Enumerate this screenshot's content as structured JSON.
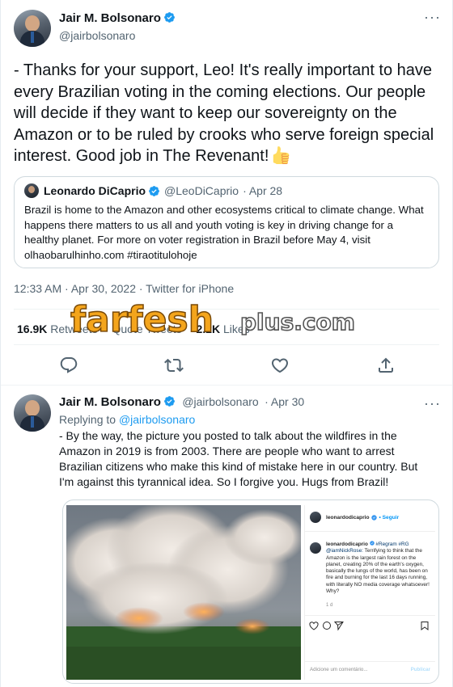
{
  "tweet": {
    "author_name": "Jair M. Bolsonaro",
    "author_handle": "@jairbolsonaro",
    "text": "- Thanks for your support, Leo! It's really important to have every Brazilian voting in the coming elections. Our people will decide if they want to keep our sovereignty on the Amazon or to be ruled by crooks who serve foreign special interest. Good job in The Revenant!",
    "quote": {
      "author_name": "Leonardo DiCaprio",
      "author_handle": "@LeoDiCaprio",
      "date": "· Apr 28",
      "text": "Brazil is home to the Amazon and other ecosystems critical to climate change. What happens there matters to us all and youth voting is key in driving change for a healthy planet. For more on voter registration in Brazil before May 4, visit olhaobarulhinho.com #tiraotitulohoje"
    },
    "timestamp": "12:33 AM · Apr 30, 2022 · Twitter for iPhone",
    "stats": {
      "retweets_count": "16.9K",
      "retweets_label": "Retweets",
      "quotes_count": "",
      "quotes_label": "Quote Tweets",
      "likes_count": "2.2K",
      "likes_label": "Likes"
    }
  },
  "watermark": {
    "brand": "farfesh",
    "suffix": "plus.com"
  },
  "reply": {
    "author_name": "Jair M. Bolsonaro",
    "author_handle": "@jairbolsonaro",
    "date": "· Apr 30",
    "replying_prefix": "Replying to",
    "replying_to": "@jairbolsonaro",
    "text": "- By the way, the picture you posted to talk about the wildfires in the Amazon in 2019 is from 2003. There are people who want to arrest Brazilian citizens who make this kind of mistake here in our country. But I'm against this tyrannical idea. So I forgive you. Hugs from Brazil!",
    "instagram": {
      "account": "leonardodicaprio",
      "follow": "• Seguir",
      "caption_user": "leonardodicaprio",
      "caption_tags": "#Regram #RG @iamNickRose:",
      "caption_text": "Terrifying to think that the Amazon is the largest rain forest on the planet, creating 20% of the earth's oxygen, basically the lungs of the world, has been on fire and burning for the last 16 days running, with literally NO media coverage whatsoever! Why?",
      "time": "1 d",
      "comment_placeholder": "Adicione um comentário...",
      "post_label": "Publicar"
    }
  },
  "colors": {
    "accent": "#1d9bf0",
    "text": "#0f1419",
    "muted": "#536471",
    "border": "#cfd9de"
  },
  "icons": [
    "verified-badge-icon",
    "more-icon",
    "thumbs-up-emoji",
    "reply-icon",
    "retweet-icon",
    "like-icon",
    "share-icon"
  ]
}
